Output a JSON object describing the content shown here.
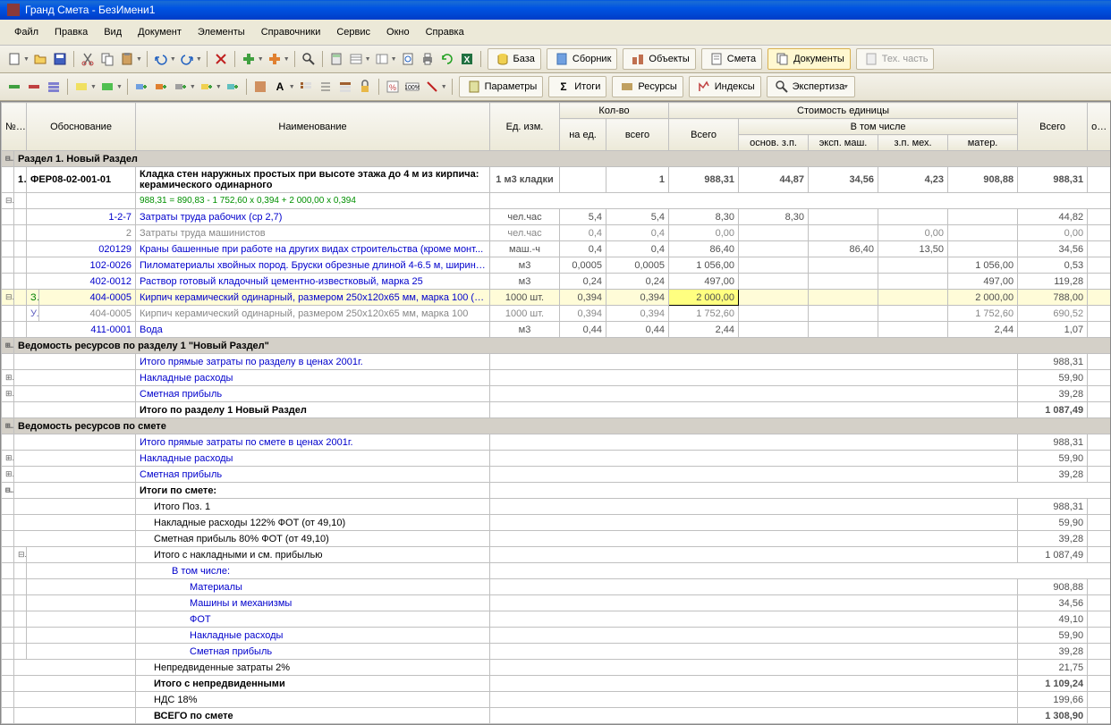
{
  "title": "Гранд Смета - БезИмени1",
  "menu": [
    "Файл",
    "Правка",
    "Вид",
    "Документ",
    "Элементы",
    "Справочники",
    "Сервис",
    "Окно",
    "Справка"
  ],
  "tabs": {
    "baza": "База",
    "sbornik": "Сборник",
    "objekty": "Объекты",
    "smeta": "Смета",
    "dokumenty": "Документы",
    "tehchast": "Тех. часть",
    "parametry": "Параметры",
    "itogi": "Итоги",
    "resursy": "Ресурсы",
    "indeksy": "Индексы",
    "ekspertiza": "Экспертиза"
  },
  "headers": {
    "npp": "№\nп.п",
    "obosnovanie": "Обоснование",
    "naimenovanie": "Наименование",
    "edizm": "Ед. изм.",
    "kolvo": "Кол-во",
    "naed": "на ед.",
    "vsego": "всего",
    "stoimost": "Стоимость единицы",
    "vsego2": "Всего",
    "vtomchisle": "В том числе",
    "osnov": "основ.",
    "osnzp": "основ. з.п.",
    "ekspmash": "эксп. маш.",
    "zpmeh": "з.п. мех.",
    "mater": "матер."
  },
  "section1": "Раздел 1. Новый Раздел",
  "rows": {
    "r1": {
      "n": "1",
      "code": "ФЕР08-02-001-01",
      "name": "Кладка стен наружных простых при высоте этажа до 4 м из кирпича: керамического одинарного",
      "formula": "988,31 = 890,83 - 1 752,60 x 0,394 + 2 000,00 x 0,394",
      "unit": "1 м3 кладки",
      "v1": "1",
      "total": "988,31",
      "c1": "44,87",
      "c2": "34,56",
      "c3": "4,23",
      "c4": "908,88",
      "sum": "988,31"
    },
    "r2": {
      "code": "1-2-7",
      "name": "Затраты труда рабочих (ср 2,7)",
      "unit": "чел.час",
      "q1": "5,4",
      "q2": "5,4",
      "total": "8,30",
      "c1": "8,30",
      "sum": "44,82"
    },
    "r3": {
      "code": "2",
      "name": "Затраты труда машинистов",
      "unit": "чел.час",
      "q1": "0,4",
      "q2": "0,4",
      "total": "0,00",
      "c3": "0,00",
      "sum": "0,00"
    },
    "r4": {
      "code": "020129",
      "name": "Краны башенные при работе на других видах строительства (кроме монт...",
      "unit": "маш.-ч",
      "q1": "0,4",
      "q2": "0,4",
      "total": "86,40",
      "c2": "86,40",
      "c3": "13,50",
      "sum": "34,56"
    },
    "r5": {
      "code": "102-0026",
      "name": "Пиломатериалы хвойных пород. Бруски обрезные длиной 4-6.5 м, ширино...",
      "unit": "м3",
      "q1": "0,0005",
      "q2": "0,0005",
      "total": "1 056,00",
      "c4": "1 056,00",
      "sum": "0,53"
    },
    "r6": {
      "code": "402-0012",
      "name": "Раствор готовый кладочный цементно-известковый, марка 25",
      "unit": "м3",
      "q1": "0,24",
      "q2": "0,24",
      "total": "497,00",
      "c4": "497,00",
      "sum": "119,28"
    },
    "r7": {
      "mark": "З",
      "code": "404-0005",
      "name": "Кирпич керамический одинарный, размером 250х120х65 мм, марка 100 (по ...",
      "unit": "1000 шт.",
      "q1": "0,394",
      "q2": "0,394",
      "total": "2 000,00",
      "c4": "2 000,00",
      "sum": "788,00"
    },
    "r8": {
      "mark": "Уд",
      "code": "404-0005",
      "name": "Кирпич керамический одинарный, размером 250х120х65 мм, марка 100",
      "unit": "1000 шт.",
      "q1": "0,394",
      "q2": "0,394",
      "total": "1 752,60",
      "c4": "1 752,60",
      "sum": "690,52"
    },
    "r9": {
      "code": "411-0001",
      "name": "Вода",
      "unit": "м3",
      "q1": "0,44",
      "q2": "0,44",
      "total": "2,44",
      "c4": "2,44",
      "sum": "1,07"
    }
  },
  "section2": "Ведомость ресурсов по разделу 1 \"Новый Раздел\"",
  "summary1": {
    "s1": {
      "name": "Итого прямые затраты по разделу в ценах 2001г.",
      "sum": "988,31"
    },
    "s2": {
      "name": "Накладные расходы",
      "sum": "59,90"
    },
    "s3": {
      "name": "Сметная прибыль",
      "sum": "39,28"
    },
    "s4": {
      "name": "Итого по разделу 1 Новый Раздел",
      "sum": "1 087,49"
    }
  },
  "section3": "Ведомость ресурсов по смете",
  "summary2": {
    "s1": {
      "name": "Итого прямые затраты по смете в ценах 2001г.",
      "sum": "988,31"
    },
    "s2": {
      "name": "Накладные расходы",
      "sum": "59,90"
    },
    "s3": {
      "name": "Сметная прибыль",
      "sum": "39,28"
    },
    "s4": {
      "name": "Итоги по смете:"
    },
    "s5": {
      "name": "Итого Поз. 1",
      "sum": "988,31"
    },
    "s6": {
      "name": "Накладные расходы 122% ФОТ (от 49,10)",
      "sum": "59,90"
    },
    "s7": {
      "name": "Сметная прибыль 80% ФОТ (от 49,10)",
      "sum": "39,28"
    },
    "s8": {
      "name": "Итого с накладными и см. прибылью",
      "sum": "1 087,49"
    },
    "s9": {
      "name": "В том числе:"
    },
    "s10": {
      "name": "Материалы",
      "sum": "908,88"
    },
    "s11": {
      "name": "Машины и механизмы",
      "sum": "34,56"
    },
    "s12": {
      "name": "ФОТ",
      "sum": "49,10"
    },
    "s13": {
      "name": "Накладные расходы",
      "sum": "59,90"
    },
    "s14": {
      "name": "Сметная прибыль",
      "sum": "39,28"
    },
    "s15": {
      "name": "Непредвиденные затраты 2%",
      "sum": "21,75"
    },
    "s16": {
      "name": "Итого с непредвиденными",
      "sum": "1 109,24"
    },
    "s17": {
      "name": "НДС 18%",
      "sum": "199,66"
    },
    "s18": {
      "name": "ВСЕГО по смете",
      "sum": "1 308,90"
    }
  }
}
